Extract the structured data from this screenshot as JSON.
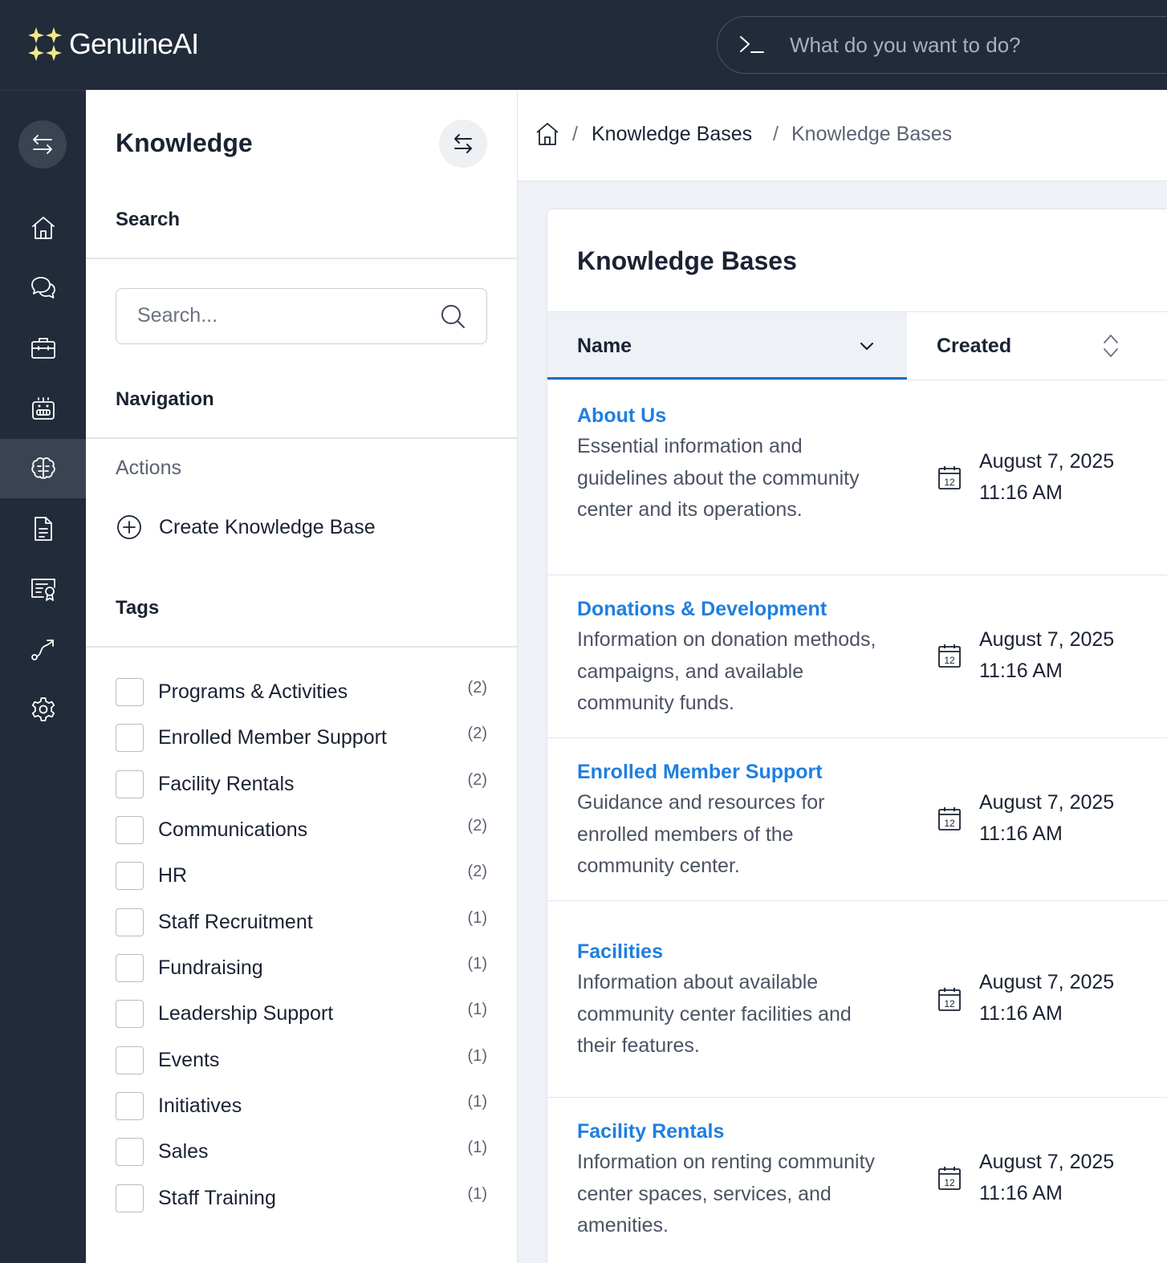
{
  "app": {
    "name": "GenuineAI",
    "command_placeholder": "What do you want to do?"
  },
  "rail": {
    "items": [
      {
        "icon": "home-icon"
      },
      {
        "icon": "chat-icon"
      },
      {
        "icon": "briefcase-icon"
      },
      {
        "icon": "robot-icon"
      },
      {
        "icon": "brain-icon",
        "active": true
      },
      {
        "icon": "document-icon"
      },
      {
        "icon": "certificate-icon"
      },
      {
        "icon": "route-icon"
      },
      {
        "icon": "gear-icon"
      }
    ]
  },
  "panel": {
    "title": "Knowledge",
    "search_label": "Search",
    "search_placeholder": "Search...",
    "navigation_label": "Navigation",
    "actions_label": "Actions",
    "create_label": "Create Knowledge Base",
    "tags_label": "Tags",
    "tags": [
      {
        "name": "Programs & Activities",
        "count": "(2)"
      },
      {
        "name": "Enrolled Member Support",
        "count": "(2)"
      },
      {
        "name": "Facility Rentals",
        "count": "(2)"
      },
      {
        "name": "Communications",
        "count": "(2)"
      },
      {
        "name": "HR",
        "count": "(2)"
      },
      {
        "name": "Staff Recruitment",
        "count": "(1)"
      },
      {
        "name": "Fundraising",
        "count": "(1)"
      },
      {
        "name": "Leadership Support",
        "count": "(1)"
      },
      {
        "name": "Events",
        "count": "(1)"
      },
      {
        "name": "Initiatives",
        "count": "(1)"
      },
      {
        "name": "Sales",
        "count": "(1)"
      },
      {
        "name": "Staff Training",
        "count": "(1)"
      }
    ]
  },
  "breadcrumb": {
    "items": [
      "Knowledge Bases",
      "Knowledge Bases"
    ],
    "separator": "/"
  },
  "main": {
    "title": "Knowledge Bases",
    "columns": {
      "name": "Name",
      "created": "Created"
    },
    "calendar_day": "12",
    "rows": [
      {
        "name": "About Us",
        "description": "Essential information and guidelines about the community center and its operations.",
        "date": "August 7, 2025",
        "time": "11:16 AM"
      },
      {
        "name": "Donations & Development",
        "description": "Information on donation methods, campaigns, and available community funds.",
        "date": "August 7, 2025",
        "time": "11:16 AM"
      },
      {
        "name": "Enrolled Member Support",
        "description": "Guidance and resources for enrolled members of the community center.",
        "date": "August 7, 2025",
        "time": "11:16 AM"
      },
      {
        "name": "Facilities",
        "description": "Information about available community center facilities and their features.",
        "date": "August 7, 2025",
        "time": "11:16 AM"
      },
      {
        "name": "Facility Rentals",
        "description": "Information on renting community center spaces, services, and amenities.",
        "date": "August 7, 2025",
        "time": "11:16 AM"
      }
    ]
  },
  "colors": {
    "topbar": "#222b3a",
    "accent": "#1f6fbf",
    "link": "#1f7fe0",
    "logo_star": "#f3e98a"
  }
}
